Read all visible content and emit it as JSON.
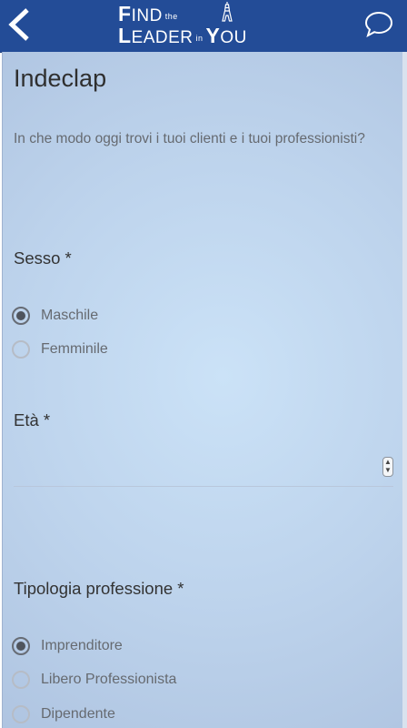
{
  "header": {
    "logo": {
      "find_big": "F",
      "find_rest": "IND",
      "the": "the",
      "leader_big": "L",
      "leader_rest": "EADER",
      "in": "in",
      "you_big": "Y",
      "you_rest": "OU"
    },
    "bar_color": "#234c97"
  },
  "form": {
    "title": "Indeclap",
    "description": "In che modo oggi trovi i tuoi clienti e i tuoi professionisti?",
    "questions": [
      {
        "label": "Sesso *",
        "options": [
          {
            "label": "Maschile",
            "checked": true
          },
          {
            "label": "Femminile",
            "checked": false
          }
        ]
      },
      {
        "label": "Età *",
        "value": ""
      },
      {
        "label": "Tipologia professione *",
        "options": [
          {
            "label": "Imprenditore",
            "checked": true
          },
          {
            "label": "Libero Professionista",
            "checked": false
          },
          {
            "label": "Dipendente",
            "checked": false
          }
        ]
      }
    ]
  }
}
